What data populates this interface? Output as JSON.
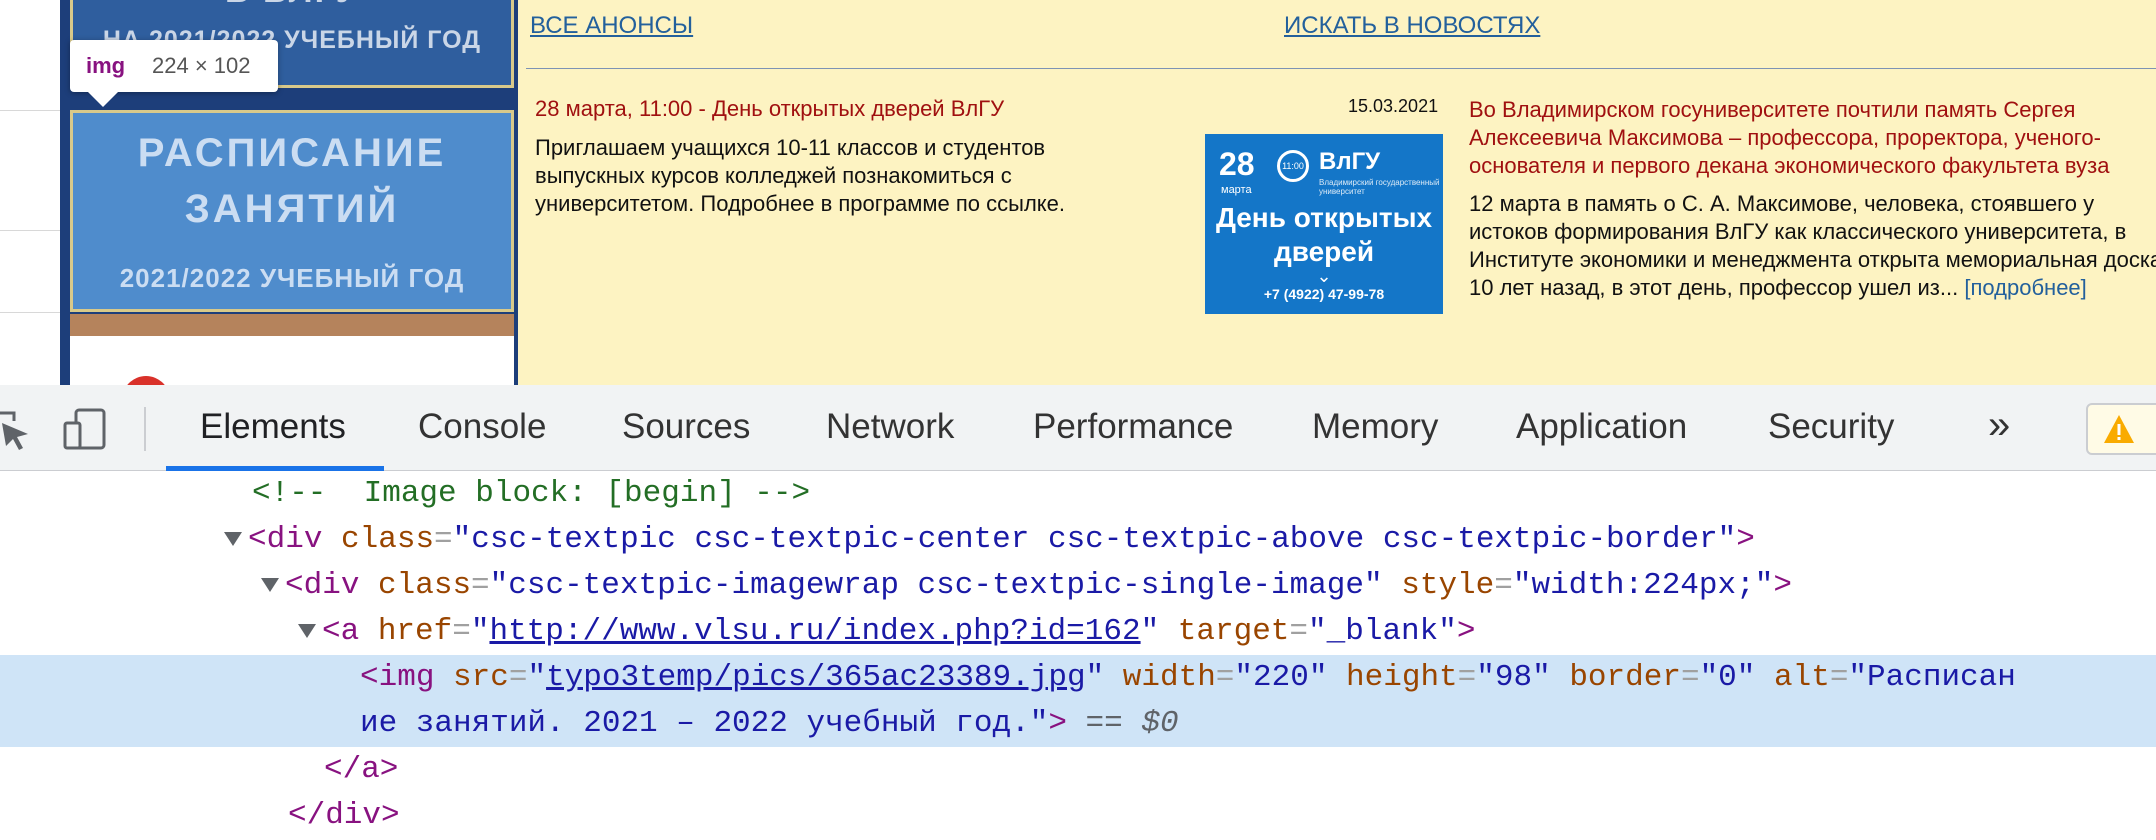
{
  "webpage": {
    "banner_top": {
      "line1": "В ВЛГУ",
      "line2": "НА 2021/2022 УЧЕБНЫЙ ГОД"
    },
    "banner_schedule": {
      "line1": "РАСПИСАНИЕ",
      "line2": "ЗАНЯТИЙ",
      "line3": "2021/2022 УЧЕБНЫЙ ГОД"
    },
    "links": {
      "all_announcements": "ВСЕ АНОНСЫ",
      "search_news": "ИСКАТЬ В НОВОСТЯХ"
    },
    "event": {
      "title": "28 марта, 11:00 - День открытых дверей ВлГУ",
      "text": "Приглашаем учащихся 10-11 классов и студентов выпускных курсов колледжей познакомиться с университетом. Подробнее в программе по ссылке."
    },
    "news_image": {
      "day": "28",
      "month": "марта",
      "time": "11:00",
      "logo": "ВлГУ",
      "logo_sub": "Владимирский государственный университет",
      "title_line1": "День открытых",
      "title_line2": "дверей",
      "phone": "+7 (4922) 47-99-78"
    },
    "news": {
      "date": "15.03.2021",
      "title": "Во Владимирском госуниверситете почтили память Сергея Алексеевича Максимова – профессора, проректора, ученого-основателя и первого декана экономического факультета вуза",
      "text": "12 марта в память о С. А. Максимове, человека, стоявшего у истоков формирования ВлГУ как классического университета, в Институте экономики и менеджмента открыта мемориальная доска. 10 лет назад, в этот день, профессор ушел из...",
      "more": "[подробнее]"
    },
    "tooltip": {
      "tag": "img",
      "dims": "224 × 102"
    }
  },
  "devtools": {
    "tabs": [
      "Elements",
      "Console",
      "Sources",
      "Network",
      "Performance",
      "Memory",
      "Application",
      "Security"
    ],
    "active_tab": "Elements",
    "more_tabs": "»",
    "icons": {
      "inspect": "inspect-cursor-icon",
      "device": "device-toolbar-icon",
      "warning": "warning-icon"
    },
    "dom": {
      "comment": "<!--  Image block: [begin] -->",
      "div1_tag": "div",
      "div1_class": "csc-textpic csc-textpic-center csc-textpic-above csc-textpic-border",
      "div2_tag": "div",
      "div2_class": "csc-textpic-imagewrap csc-textpic-single-image",
      "div2_style": "width:224px;",
      "a_tag": "a",
      "a_href": "http://www.vlsu.ru/index.php?id=162",
      "a_target": "_blank",
      "img_tag": "img",
      "img_src": "typo3temp/pics/365ac23389.jpg",
      "img_width": "220",
      "img_height": "98",
      "img_border": "0",
      "img_alt_part1": "Расписан",
      "img_alt_part2": "ие занятий. 2021 – 2022 учебный год.",
      "selected_marker": "== $0",
      "close_a": "</a>",
      "close_div": "</div>"
    }
  }
}
